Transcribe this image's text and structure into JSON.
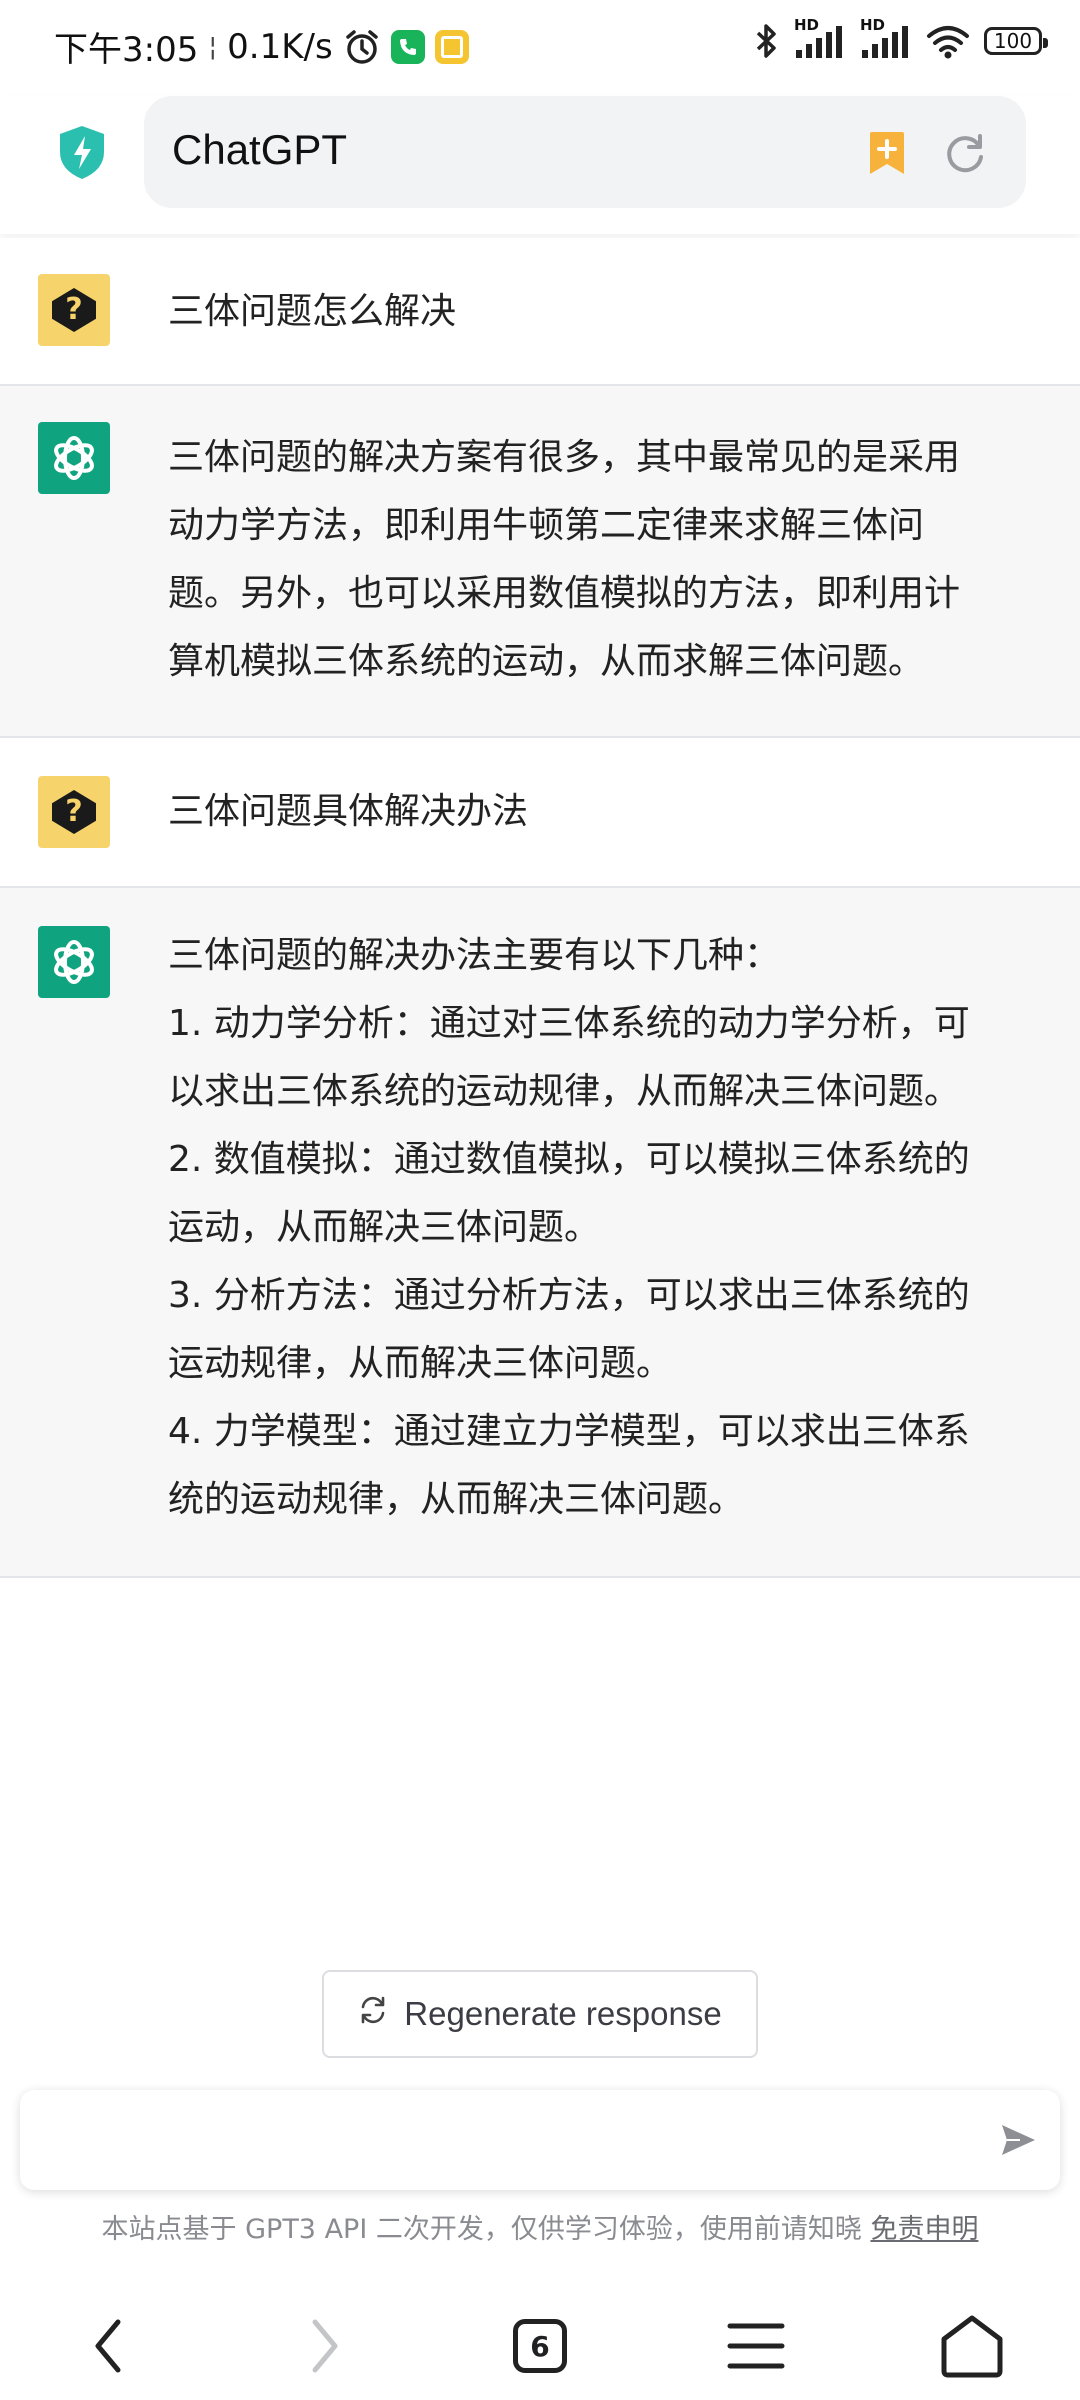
{
  "status_bar": {
    "time": "下午3:05",
    "net_speed": "0.1K/s",
    "battery": "100",
    "signal_label": "HD",
    "colors": {
      "phone_app": "#19b35a",
      "notes_app": "#f4c531"
    }
  },
  "header": {
    "title": "ChatGPT",
    "colors": {
      "shield": "#2bbfb0",
      "bookmark": "#f7b23b"
    }
  },
  "conversation": [
    {
      "role": "user",
      "text": "三体问题怎么解决"
    },
    {
      "role": "assistant",
      "text": "三体问题的解决方案有很多，其中最常见的是采用\n动力学方法，即利用牛顿第二定律来求解三体问\n题。另外，也可以采用数值模拟的方法，即利用计\n算机模拟三体系统的运动，从而求解三体问题。"
    },
    {
      "role": "user",
      "text": "三体问题具体解决办法"
    },
    {
      "role": "assistant",
      "text": "三体问题的解决办法主要有以下几种：\n1. 动力学分析：通过对三体系统的动力学分析，可\n以求出三体系统的运动规律，从而解决三体问题。\n2. 数值模拟：通过数值模拟，可以模拟三体系统的\n运动，从而解决三体问题。\n3. 分析方法：通过分析方法，可以求出三体系统的\n运动规律，从而解决三体问题。\n4. 力学模型：通过建立力学模型，可以求出三体系\n统的运动规律，从而解决三体问题。"
    }
  ],
  "regenerate": {
    "label": "Regenerate response"
  },
  "input": {
    "placeholder": "",
    "value": ""
  },
  "disclaimer": {
    "text": "本站点基于 GPT3 API 二次开发，仅供学习体验，使用前请知晓 ",
    "link": "免责申明"
  },
  "bottom_nav": {
    "tab_count": "6"
  },
  "colors": {
    "assistant_avatar": "#10a37f",
    "user_avatar": "#f6d36b",
    "assistant_bg": "#f7f7f8"
  }
}
